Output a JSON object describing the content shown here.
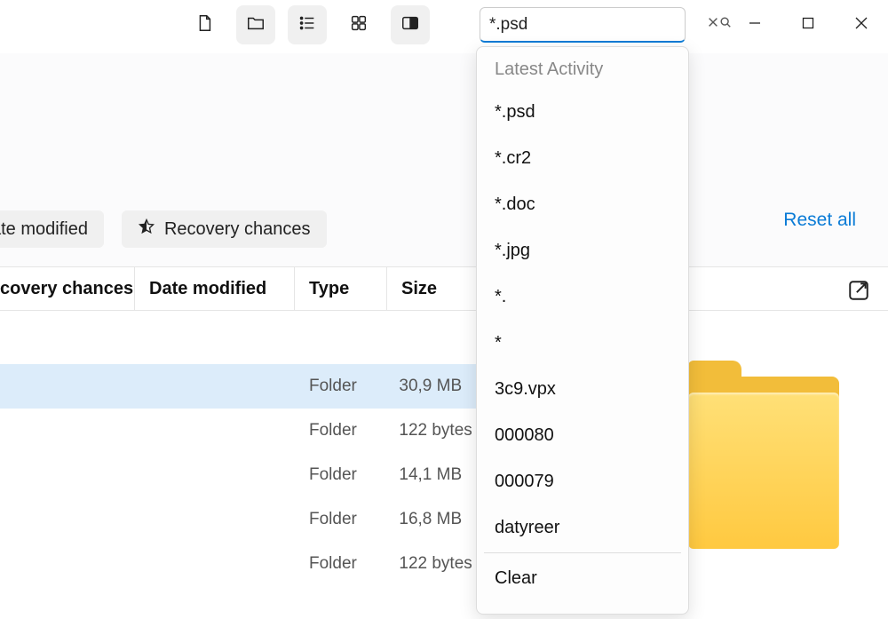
{
  "search": {
    "value": "*.psd"
  },
  "filters": {
    "date_modified_label_partial": "ate modified",
    "recovery_label": "Recovery chances",
    "reset_label": "Reset all"
  },
  "columns": {
    "chances_partial": "covery chances",
    "date": "Date modified",
    "type": "Type",
    "size": "Size"
  },
  "rows": [
    {
      "type": "Folder",
      "size": "30,9 MB",
      "selected": true
    },
    {
      "type": "Folder",
      "size": "122 bytes",
      "selected": false
    },
    {
      "type": "Folder",
      "size": "14,1 MB",
      "selected": false
    },
    {
      "type": "Folder",
      "size": "16,8 MB",
      "selected": false
    },
    {
      "type": "Folder",
      "size": "122 bytes",
      "selected": false
    }
  ],
  "dropdown": {
    "header": "Latest Activity",
    "items": [
      "*.psd",
      "*.cr2",
      "*.doc",
      "*.jpg",
      "*.",
      "*",
      "3c9.vpx",
      "000080",
      "000079",
      "datyreer"
    ],
    "clear_label": "Clear"
  }
}
